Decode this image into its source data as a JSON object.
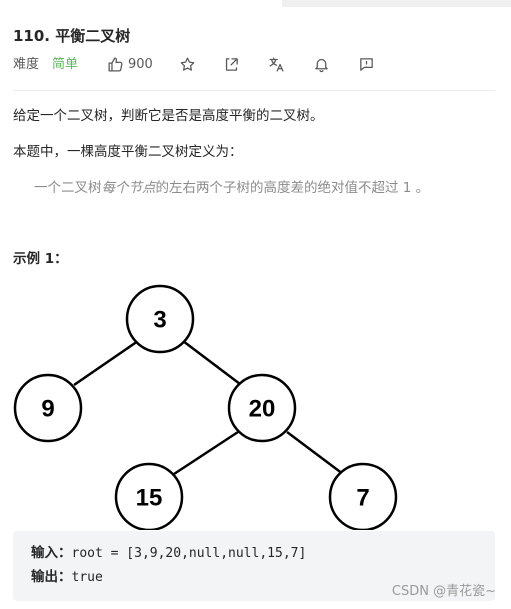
{
  "problem": {
    "title": "110. 平衡二叉树",
    "difficulty_label": "难度",
    "difficulty": "简单",
    "likes": "900"
  },
  "toolbar": {
    "icons": [
      "thumb-up-icon",
      "star-icon",
      "share-icon",
      "translate-icon",
      "bell-icon",
      "feedback-icon"
    ]
  },
  "description": {
    "p1": "给定一个二叉树，判断它是否是高度平衡的二叉树。",
    "p2": "本题中，一棵高度平衡二叉树定义为：",
    "quote_a": "一个二叉树",
    "quote_b": "每个节点",
    "quote_c": "的左右两个子树的高度差的绝对值不超过 1 。"
  },
  "example": {
    "title": "示例 1：",
    "tree_nodes": [
      "3",
      "9",
      "20",
      "15",
      "7"
    ],
    "input_label": "输入：",
    "input_value": "root = [3,9,20,null,null,15,7]",
    "output_label": "输出：",
    "output_value": "true"
  },
  "watermark": "CSDN @青花瓷~",
  "colors": {
    "easy": "#5cb85c",
    "muted": "#8c8c8c",
    "code_bg": "#f3f4f5"
  }
}
